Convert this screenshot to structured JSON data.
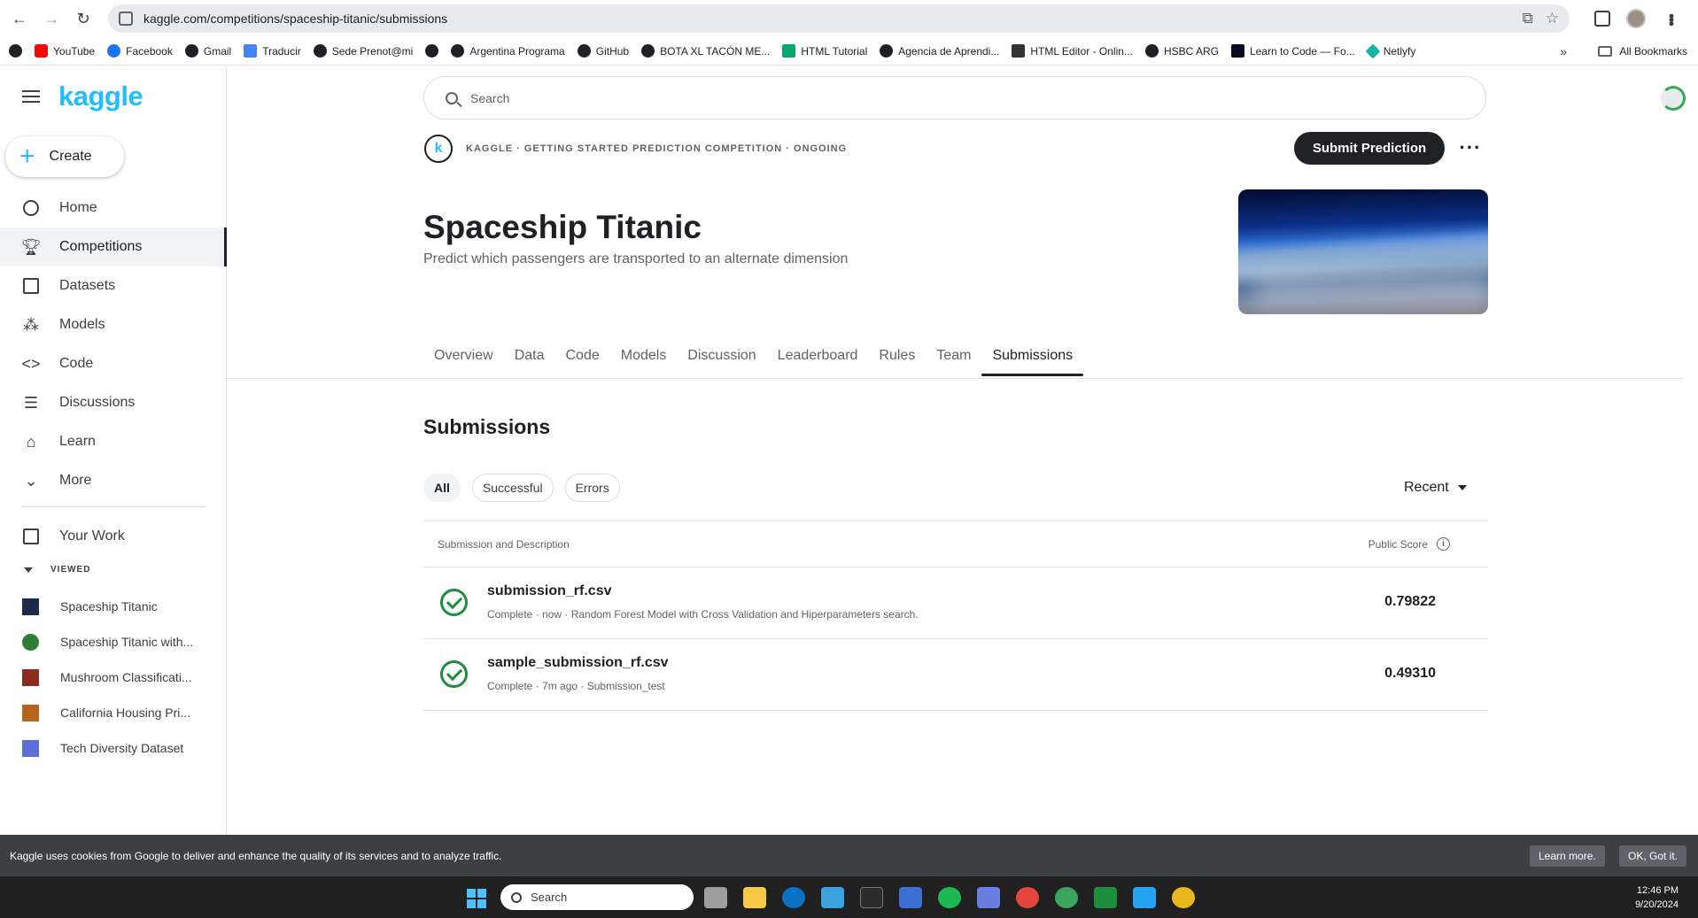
{
  "browser": {
    "url": "kaggle.com/competitions/spaceship-titanic/submissions",
    "bookmarks": [
      {
        "label": "",
        "icon": "globe-icon"
      },
      {
        "label": "YouTube",
        "icon": "youtube-icon"
      },
      {
        "label": "Facebook",
        "icon": "facebook-icon"
      },
      {
        "label": "Gmail",
        "icon": "globe-icon"
      },
      {
        "label": "Traducir",
        "icon": "translate-icon"
      },
      {
        "label": "Sede Prenot@mi",
        "icon": "globe-icon"
      },
      {
        "label": "",
        "icon": "globe-icon"
      },
      {
        "label": "Argentina Programa",
        "icon": "globe-icon"
      },
      {
        "label": "GitHub",
        "icon": "github-icon"
      },
      {
        "label": "BOTA XL TACÓN ME...",
        "icon": "globe-icon"
      },
      {
        "label": "HTML Tutorial",
        "icon": "w3schools-icon"
      },
      {
        "label": "Agencia de Aprendi...",
        "icon": "globe-icon"
      },
      {
        "label": "HTML Editor - Onlin...",
        "icon": "editor-icon"
      },
      {
        "label": "HSBC ARG",
        "icon": "globe-icon"
      },
      {
        "label": "Learn to Code — Fo...",
        "icon": "freecodecamp-icon"
      },
      {
        "label": "Netlyfy",
        "icon": "netlify-icon"
      }
    ],
    "more_bookmarks": "»",
    "all_bookmarks": "All Bookmarks"
  },
  "sidebar": {
    "logo": "kaggle",
    "create_label": "Create",
    "nav": [
      {
        "label": "Home",
        "icon": "compass-icon"
      },
      {
        "label": "Competitions",
        "icon": "trophy-icon"
      },
      {
        "label": "Datasets",
        "icon": "table-icon"
      },
      {
        "label": "Models",
        "icon": "models-icon"
      },
      {
        "label": "Code",
        "icon": "code-icon"
      },
      {
        "label": "Discussions",
        "icon": "discussion-icon"
      },
      {
        "label": "Learn",
        "icon": "graduation-cap-icon"
      },
      {
        "label": "More",
        "icon": "chevron-down-icon"
      }
    ],
    "your_work": "Your Work",
    "viewed_header": "VIEWED",
    "recent": [
      {
        "label": "Spaceship Titanic",
        "color": "#1b2a4a"
      },
      {
        "label": "Spaceship Titanic with...",
        "color": "#2e7d32"
      },
      {
        "label": "Mushroom Classificati...",
        "color": "#8d2b1f"
      },
      {
        "label": "California Housing Pri...",
        "color": "#b5651d"
      },
      {
        "label": "Tech Diversity Dataset",
        "color": "#5b6fd6"
      }
    ]
  },
  "header": {
    "search_placeholder": "Search",
    "breadcrumb": "KAGGLE · GETTING STARTED PREDICTION COMPETITION · ONGOING",
    "logo_letter": "k",
    "submit_label": "Submit Prediction",
    "more_label": "···"
  },
  "competition": {
    "title": "Spaceship Titanic",
    "subtitle": "Predict which passengers are transported to an alternate dimension"
  },
  "tabs": [
    "Overview",
    "Data",
    "Code",
    "Models",
    "Discussion",
    "Leaderboard",
    "Rules",
    "Team",
    "Submissions"
  ],
  "active_tab": "Submissions",
  "submissions": {
    "title": "Submissions",
    "filters": [
      "All",
      "Successful",
      "Errors"
    ],
    "sort": "Recent",
    "columns": {
      "description": "Submission and Description",
      "score": "Public Score"
    },
    "rows": [
      {
        "file": "submission_rf.csv",
        "status": "Complete · now · Random Forest Model with Cross Validation and Hiperparameters search.",
        "score": "0.79822"
      },
      {
        "file": "sample_submission_rf.csv",
        "status": "Complete · 7m ago · Submission_test",
        "score": "0.49310"
      }
    ]
  },
  "cookie": {
    "text": "Kaggle uses cookies from Google to deliver and enhance the quality of its services and to analyze traffic.",
    "learn_more": "Learn more.",
    "ok": "OK, Got it."
  },
  "taskbar": {
    "search": "Search",
    "time": "12:46 PM",
    "date": "9/20/2024",
    "apps": [
      {
        "name": "task-view",
        "color": "#9e9e9e"
      },
      {
        "name": "file-explorer",
        "color": "#f7c948"
      },
      {
        "name": "dell",
        "color": "#0b72c4"
      },
      {
        "name": "photos",
        "color": "#3aa0e0"
      },
      {
        "name": "terminal",
        "color": "#2b2b2b"
      },
      {
        "name": "word-app",
        "color": "#3b6fd1"
      },
      {
        "name": "spotify",
        "color": "#1db954"
      },
      {
        "name": "network",
        "color": "#6a7de0"
      },
      {
        "name": "chrome",
        "color": "#e5453b"
      },
      {
        "name": "chrome-2",
        "color": "#3ba55c"
      },
      {
        "name": "sheets",
        "color": "#1e8e3e"
      },
      {
        "name": "vscode",
        "color": "#23a3f0"
      },
      {
        "name": "chrome-3",
        "color": "#e8b81c"
      }
    ]
  }
}
